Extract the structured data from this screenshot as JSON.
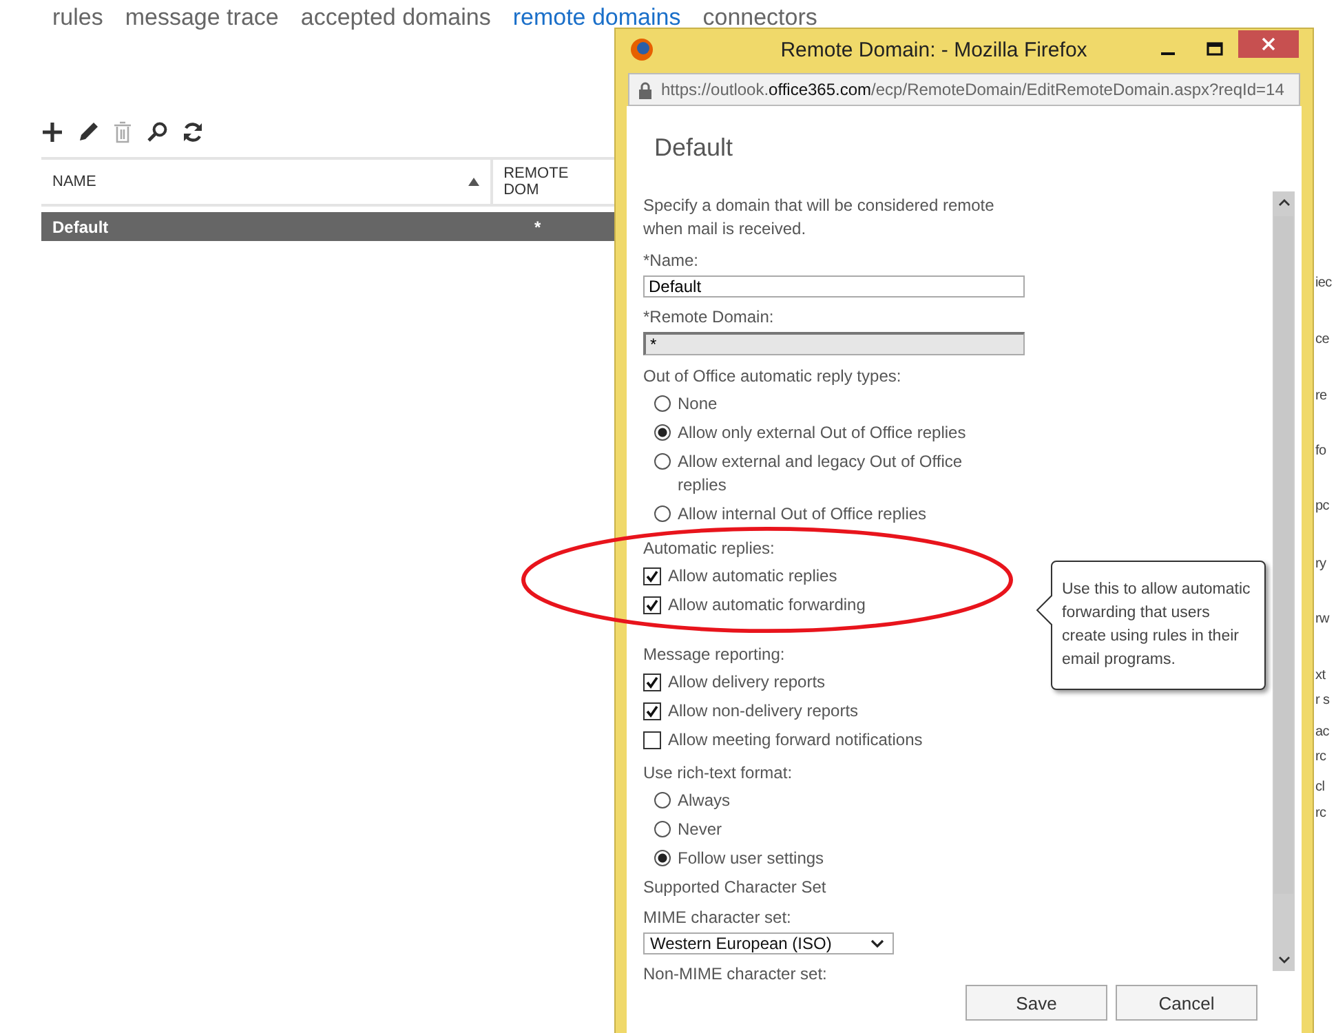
{
  "tabs": [
    {
      "label": "rules",
      "selected": false
    },
    {
      "label": "message trace",
      "selected": false
    },
    {
      "label": "accepted domains",
      "selected": false
    },
    {
      "label": "remote domains",
      "selected": true
    },
    {
      "label": "connectors",
      "selected": false
    }
  ],
  "toolbar": [
    {
      "kind": "add",
      "disabled": false
    },
    {
      "kind": "edit",
      "disabled": false
    },
    {
      "kind": "delete",
      "disabled": true
    },
    {
      "kind": "search",
      "disabled": false
    },
    {
      "kind": "refresh",
      "disabled": false
    }
  ],
  "table": {
    "columns": [
      {
        "label": "NAME",
        "sorted": true
      },
      {
        "label": "REMOTE DOM",
        "sorted": false
      }
    ],
    "rows": [
      {
        "cells": [
          "Default",
          "*"
        ],
        "selected": true
      }
    ]
  },
  "side_fragments": [
    "iec",
    "ce",
    "re",
    "fo",
    "pc",
    "ry",
    "rw",
    "xt",
    "r s",
    "ac",
    "rc",
    "cl",
    "rc"
  ],
  "window": {
    "title": "Remote Domain: - Mozilla Firefox",
    "url": "https://outlook.**office365.com**/ecp/RemoteDomain/EditRemoteDomain.aspx?reqId=14",
    "heading": "Default",
    "intro": "Specify a domain that will be considered remote when mail is received.",
    "fields": [
      {
        "label": "*Name:",
        "value": "Default",
        "disabled": false
      },
      {
        "label": "*Remote Domain:",
        "value": "*",
        "disabled": true
      }
    ],
    "sections": [
      {
        "kind": "radio",
        "label": "Out of Office automatic reply types:",
        "options": [
          {
            "label": "None",
            "selected": false
          },
          {
            "label": "Allow only external Out of Office replies",
            "selected": true
          },
          {
            "label": "Allow external and legacy Out of Office replies",
            "selected": false
          },
          {
            "label": "Allow internal Out of Office replies",
            "selected": false
          }
        ]
      },
      {
        "kind": "checkbox",
        "circled": true,
        "label": "Automatic replies:",
        "options": [
          {
            "label": "Allow automatic replies",
            "checked": true
          },
          {
            "label": "Allow automatic forwarding",
            "checked": true
          }
        ]
      },
      {
        "kind": "checkbox",
        "circled": false,
        "label": "Message reporting:",
        "options": [
          {
            "label": "Allow delivery reports",
            "checked": true
          },
          {
            "label": "Allow non-delivery reports",
            "checked": true
          },
          {
            "label": "Allow meeting forward notifications",
            "checked": false
          }
        ]
      },
      {
        "kind": "radio",
        "label": "Use rich-text format:",
        "options": [
          {
            "label": "Always",
            "selected": false
          },
          {
            "label": "Never",
            "selected": false
          },
          {
            "label": "Follow user settings",
            "selected": true
          }
        ]
      },
      {
        "kind": "select",
        "label": "Supported Character Set",
        "sublabel": "MIME character set:",
        "value": "Western European (ISO)"
      },
      {
        "kind": "label",
        "label": "Non-MIME character set:"
      }
    ],
    "tooltip": "Use this to allow automatic forwarding that users create using rules in their email programs.",
    "buttons": [
      "Save",
      "Cancel"
    ]
  }
}
